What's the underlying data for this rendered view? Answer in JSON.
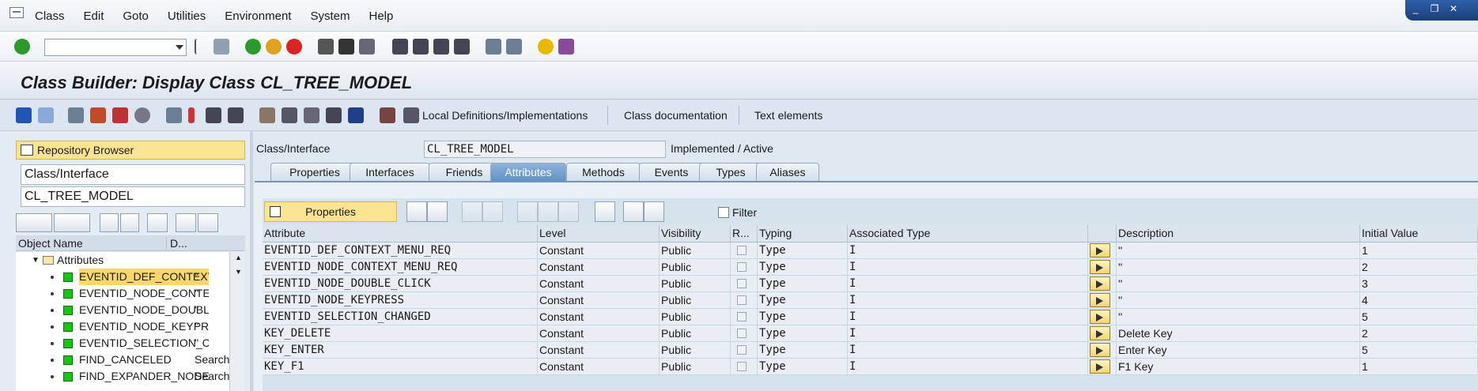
{
  "menu": [
    "Class",
    "Edit",
    "Goto",
    "Utilities",
    "Environment",
    "System",
    "Help"
  ],
  "window_controls": [
    "_",
    "❐",
    "✕"
  ],
  "title": "Class Builder: Display Class CL_TREE_MODEL",
  "app_toolbar": {
    "local_defs": "Local Definitions/Implementations",
    "class_doc": "Class documentation",
    "text_elements": "Text elements"
  },
  "left": {
    "repo_browser": "Repository Browser",
    "object_type": "Class/Interface",
    "object_name": "CL_TREE_MODEL",
    "col_object_name": "Object Name",
    "col_desc": "D...",
    "folder": "Attributes",
    "items": [
      {
        "name": "EVENTID_DEF_CONTEXT_MENU_REQ",
        "desc": "''"
      },
      {
        "name": "EVENTID_NODE_CONTEXT_MENU_REQ",
        "desc": "''"
      },
      {
        "name": "EVENTID_NODE_DOUBLE_CLICK",
        "desc": "''"
      },
      {
        "name": "EVENTID_NODE_KEYPRESS",
        "desc": "''"
      },
      {
        "name": "EVENTID_SELECTION_CHANGED",
        "desc": "''"
      },
      {
        "name": "FIND_CANCELED",
        "desc": "Search"
      },
      {
        "name": "FIND_EXPANDER_NODE",
        "desc": "Search"
      }
    ]
  },
  "header": {
    "label": "Class/Interface",
    "value": "CL_TREE_MODEL",
    "status": "Implemented / Active"
  },
  "tabs": [
    "Properties",
    "Interfaces",
    "Friends",
    "Attributes",
    "Methods",
    "Events",
    "Types",
    "Aliases"
  ],
  "active_tab": "Attributes",
  "grid_toolbar": {
    "properties_btn": "Properties",
    "filter_label": "Filter"
  },
  "grid": {
    "columns": [
      "Attribute",
      "Level",
      "Visibility",
      "R...",
      "Typing",
      "Associated Type",
      "",
      "Description",
      "Initial Value"
    ],
    "rows": [
      {
        "attribute": "EVENTID_DEF_CONTEXT_MENU_REQ",
        "level": "Constant",
        "visibility": "Public",
        "typing": "Type",
        "assoc": "I",
        "description": "''",
        "initial": "1"
      },
      {
        "attribute": "EVENTID_NODE_CONTEXT_MENU_REQ",
        "level": "Constant",
        "visibility": "Public",
        "typing": "Type",
        "assoc": "I",
        "description": "''",
        "initial": "2"
      },
      {
        "attribute": "EVENTID_NODE_DOUBLE_CLICK",
        "level": "Constant",
        "visibility": "Public",
        "typing": "Type",
        "assoc": "I",
        "description": "''",
        "initial": "3"
      },
      {
        "attribute": "EVENTID_NODE_KEYPRESS",
        "level": "Constant",
        "visibility": "Public",
        "typing": "Type",
        "assoc": "I",
        "description": "''",
        "initial": "4"
      },
      {
        "attribute": "EVENTID_SELECTION_CHANGED",
        "level": "Constant",
        "visibility": "Public",
        "typing": "Type",
        "assoc": "I",
        "description": "''",
        "initial": "5"
      },
      {
        "attribute": "KEY_DELETE",
        "level": "Constant",
        "visibility": "Public",
        "typing": "Type",
        "assoc": "I",
        "description": "Delete Key",
        "initial": "2"
      },
      {
        "attribute": "KEY_ENTER",
        "level": "Constant",
        "visibility": "Public",
        "typing": "Type",
        "assoc": "I",
        "description": "Enter Key",
        "initial": "5"
      },
      {
        "attribute": "KEY_F1",
        "level": "Constant",
        "visibility": "Public",
        "typing": "Type",
        "assoc": "I",
        "description": "F1 Key",
        "initial": "1"
      }
    ]
  },
  "colors": {
    "accent_yellow": "#fbe491",
    "tab_active": "#5f8fc4",
    "selection": "#fbd76b",
    "status_green": "#18c418"
  }
}
